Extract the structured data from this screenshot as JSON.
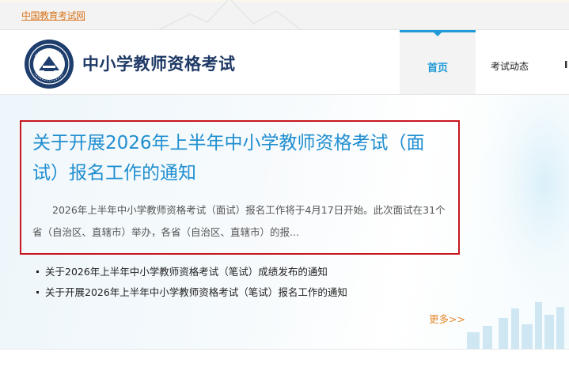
{
  "topbar": {
    "link": "中国教育考试网"
  },
  "header": {
    "site_title": "中小学教师资格考试",
    "nav": [
      {
        "label": "首页",
        "active": true
      },
      {
        "label": "考试动态"
      },
      {
        "label": "I"
      }
    ]
  },
  "feature": {
    "title": "关于开展2026年上半年中小学教师资格考试（面试）报名工作的通知",
    "summary": "2026年上半年中小学教师资格考试（面试）报名工作将于4月17日开始。此次面试在31个省（自治区、直辖市）举办，各省（自治区、直辖市）的报..."
  },
  "news": [
    "关于2026年上半年中小学教师资格考试（笔试）成绩发布的通知",
    "关于开展2026年上半年中小学教师资格考试（笔试）报名工作的通知"
  ],
  "more_label": "更多>>",
  "colors": {
    "accent": "#1f9ad6",
    "title_blue": "#1f8ed0",
    "highlight_red": "#c8161e",
    "link_orange": "#e6862a"
  },
  "icons": {
    "logo": "teacher-certification-emblem",
    "ridge": "mountain-outline-decoration",
    "city": "city-skyline-decoration"
  }
}
